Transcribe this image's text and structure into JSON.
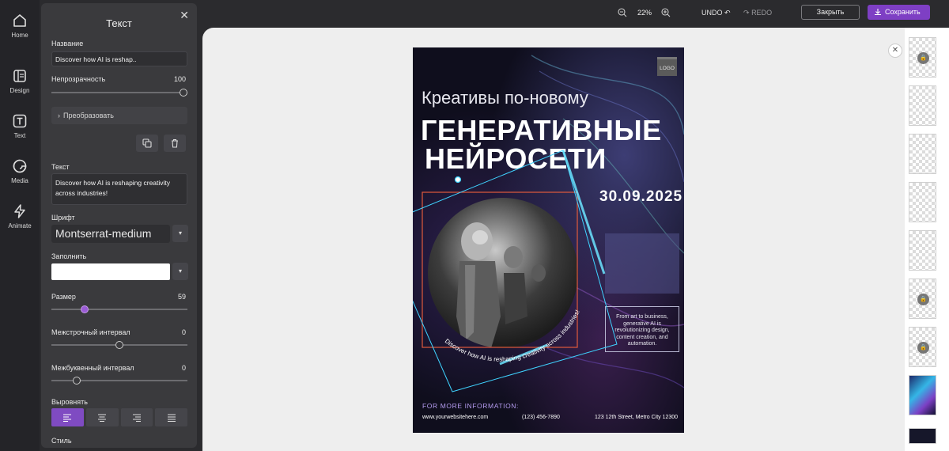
{
  "nav": {
    "items": [
      {
        "label": "Home",
        "icon": "home-icon"
      },
      {
        "label": "Design",
        "icon": "design-icon"
      },
      {
        "label": "Text",
        "icon": "text-icon"
      },
      {
        "label": "Media",
        "icon": "media-icon"
      },
      {
        "label": "Animate",
        "icon": "animate-icon"
      }
    ]
  },
  "panel": {
    "title": "Текст",
    "name_label": "Название",
    "name_value": "Discover how AI is reshap..",
    "opacity_label": "Непрозрачность",
    "opacity_value": "100",
    "transform_label": "Преобразовать",
    "text_label": "Текст",
    "text_value": "Discover how AI is reshaping creativity across industries!",
    "font_label": "Шрифт",
    "font_value": "Montserrat-medium",
    "fill_label": "Заполнить",
    "fill_color": "#ffffff",
    "size_label": "Размер",
    "size_value": "59",
    "line_spacing_label": "Межстрочный интервал",
    "line_spacing_value": "0",
    "letter_spacing_label": "Межбуквенный интервал",
    "letter_spacing_value": "0",
    "align_label": "Выровнять",
    "style_label": "Стиль"
  },
  "toolbar": {
    "zoom": "22%",
    "undo": "UNDO",
    "redo": "REDO",
    "close": "Закрыть",
    "save": "Сохранить",
    "accent": "#7e3fc4"
  },
  "poster": {
    "logo": "LOGO",
    "subtitle": "Креативы по-новому",
    "title_line1": "ГЕНЕРАТИВНЫЕ",
    "title_line2": "НЕЙРОСЕТИ",
    "date": "30.09.2025",
    "curved_caption": "Discover how AI is reshaping creativity across industries!",
    "box_text": "From art to business, generative AI is revolutionizing design, content creation, and automation.",
    "more_info": "FOR MORE INFORMATION:",
    "website": "www.yourwebsitehere.com",
    "phone": "(123) 456-7890",
    "address": "123 12th Street, Metro City 12300"
  }
}
